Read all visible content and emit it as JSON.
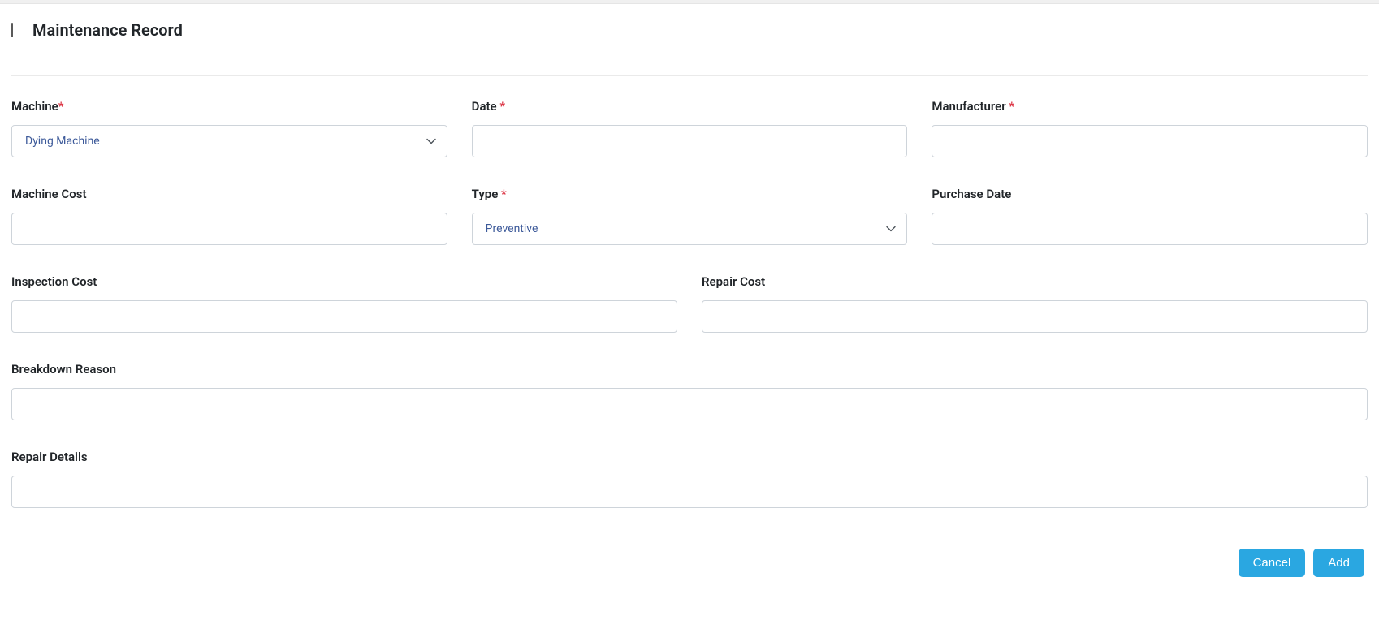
{
  "header": {
    "title": "Maintenance Record"
  },
  "fields": {
    "machine": {
      "label": "Machine",
      "value": "Dying Machine",
      "required": "*"
    },
    "date": {
      "label": "Date ",
      "value": "",
      "required": "*"
    },
    "manufacturer": {
      "label": "Manufacturer ",
      "value": "",
      "required": "*"
    },
    "machine_cost": {
      "label": "Machine Cost",
      "value": ""
    },
    "type": {
      "label": "Type ",
      "value": "Preventive",
      "required": "*"
    },
    "purchase_date": {
      "label": "Purchase Date",
      "value": ""
    },
    "inspection_cost": {
      "label": "Inspection Cost",
      "value": ""
    },
    "repair_cost": {
      "label": "Repair Cost",
      "value": ""
    },
    "breakdown_reason": {
      "label": "Breakdown Reason",
      "value": ""
    },
    "repair_details": {
      "label": "Repair Details",
      "value": ""
    }
  },
  "actions": {
    "cancel": "Cancel",
    "add": "Add"
  }
}
